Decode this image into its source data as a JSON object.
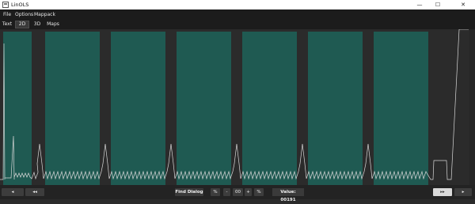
{
  "window": {
    "title": "LinOLS",
    "minimize_glyph": "—",
    "maximize_glyph": "☐",
    "close_glyph": "✕"
  },
  "menu": {
    "items": [
      "File",
      "Options",
      "Mappack"
    ]
  },
  "view_tabs": {
    "items": [
      "Text",
      "2D",
      "3D",
      "Maps"
    ],
    "active": "2D"
  },
  "colors": {
    "background": "#2b2b2b",
    "map_fill": "#1f5a52",
    "waveform": "#d8d8d8",
    "bar": "#1c1c1c"
  },
  "icons": {
    "scroll_left": "left-arrow-icon",
    "scroll_right": "right-arrow-icon",
    "page_left": "double-left-arrow-icon",
    "page_right": "double-right-arrow-icon"
  },
  "bottombar": {
    "scroll_left_glyph": "◂",
    "page_left_glyph": "◂◂",
    "find_dialog_label": "Find Dialog",
    "percent_label_1": "%",
    "minus_label": "-",
    "hex_label": "00",
    "plus_label": "+",
    "percent_label_2": "%",
    "value_label": "Value: 00191",
    "page_right_glyph": "▸▸",
    "scroll_right_glyph": "▸"
  }
}
